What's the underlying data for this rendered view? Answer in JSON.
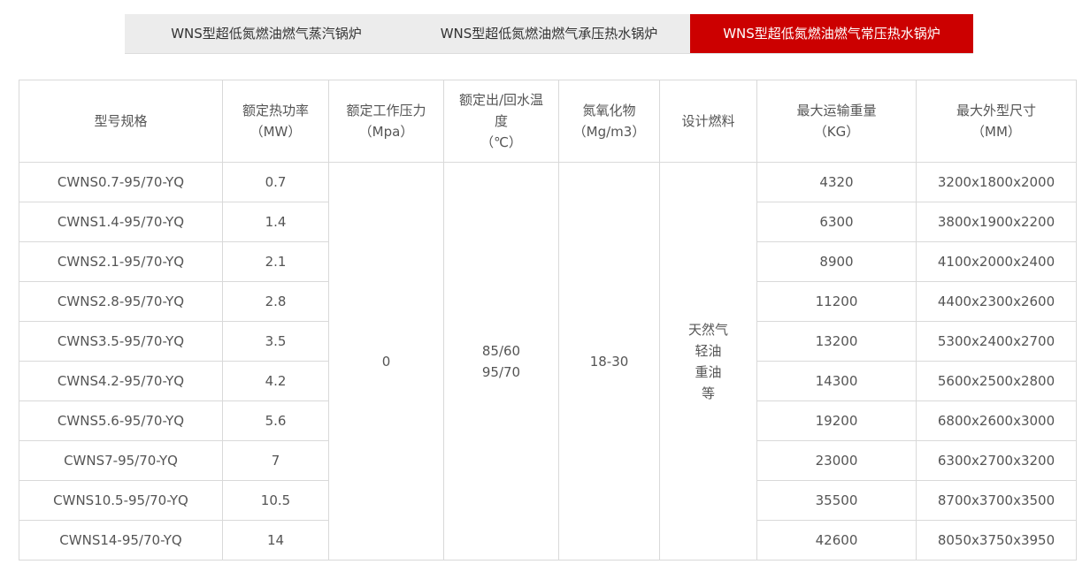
{
  "tabs": [
    {
      "label": "WNS型超低氮燃油燃气蒸汽锅炉"
    },
    {
      "label": "WNS型超低氮燃油燃气承压热水锅炉"
    },
    {
      "label": "WNS型超低氮燃油燃气常压热水锅炉"
    }
  ],
  "active_color": "#cc0000",
  "table": {
    "headers": [
      [
        "型号规格"
      ],
      [
        "额定热功率",
        "（MW）"
      ],
      [
        "额定工作压力",
        "（Mpa）"
      ],
      [
        "额定出/回水温",
        "度",
        "（℃）"
      ],
      [
        "氮氧化物",
        "（Mg/m3）"
      ],
      [
        "设计燃料"
      ],
      [
        "最大运输重量",
        "（KG）"
      ],
      [
        "最大外型尺寸",
        "（MM）"
      ]
    ],
    "rows": [
      {
        "model": "CWNS0.7-95/70-YQ",
        "power": "0.7",
        "weight": "4320",
        "size": "3200x1800x2000"
      },
      {
        "model": "CWNS1.4-95/70-YQ",
        "power": "1.4",
        "weight": "6300",
        "size": "3800x1900x2200"
      },
      {
        "model": "CWNS2.1-95/70-YQ",
        "power": "2.1",
        "weight": "8900",
        "size": "4100x2000x2400"
      },
      {
        "model": "CWNS2.8-95/70-YQ",
        "power": "2.8",
        "weight": "11200",
        "size": "4400x2300x2600"
      },
      {
        "model": "CWNS3.5-95/70-YQ",
        "power": "3.5",
        "weight": "13200",
        "size": "5300x2400x2700"
      },
      {
        "model": "CWNS4.2-95/70-YQ",
        "power": "4.2",
        "weight": "14300",
        "size": "5600x2500x2800"
      },
      {
        "model": "CWNS5.6-95/70-YQ",
        "power": "5.6",
        "weight": "19200",
        "size": "6800x2600x3000"
      },
      {
        "model": "CWNS7-95/70-YQ",
        "power": "7",
        "weight": "23000",
        "size": "6300x2700x3200"
      },
      {
        "model": "CWNS10.5-95/70-YQ",
        "power": "10.5",
        "weight": "35500",
        "size": "8700x3700x3500"
      },
      {
        "model": "CWNS14-95/70-YQ",
        "power": "14",
        "weight": "42600",
        "size": "8050x3750x3950"
      }
    ],
    "shared": {
      "pressure": "0",
      "temp": [
        "85/60",
        "95/70"
      ],
      "nox": "18-30",
      "fuel": [
        "天然气",
        "轻油",
        "重油",
        "等"
      ]
    }
  }
}
